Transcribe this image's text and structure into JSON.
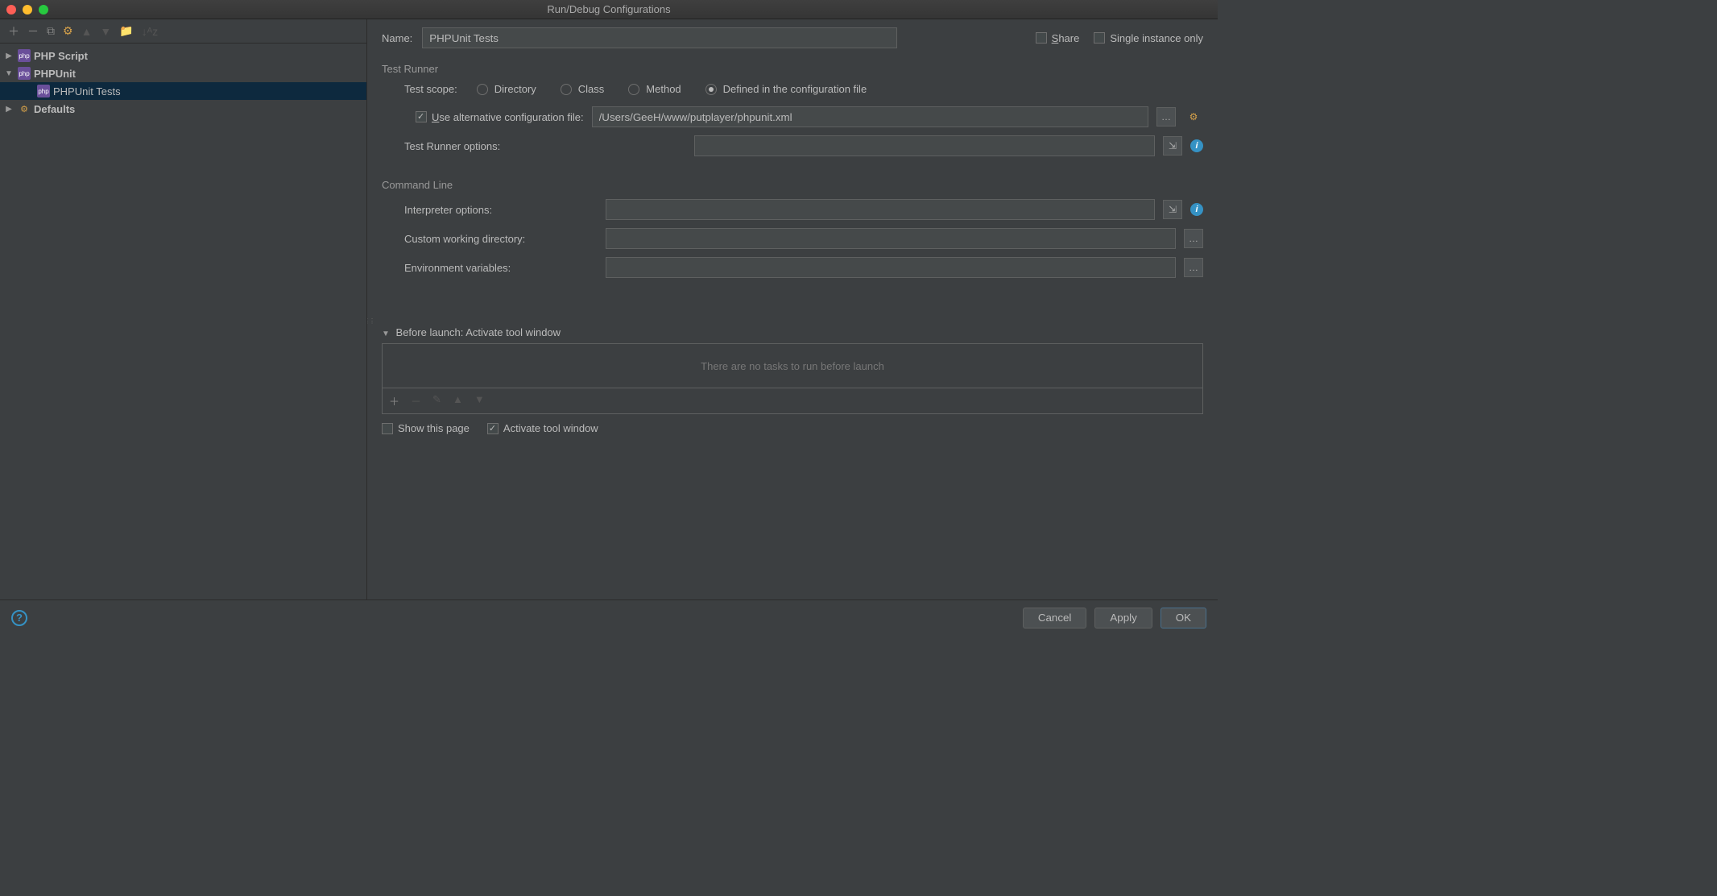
{
  "window": {
    "title": "Run/Debug Configurations"
  },
  "tree": {
    "items": [
      {
        "label": "PHP Script",
        "icon": "php",
        "expanded": false
      },
      {
        "label": "PHPUnit",
        "icon": "php",
        "expanded": true,
        "children": [
          {
            "label": "PHPUnit Tests",
            "icon": "php",
            "selected": true
          }
        ]
      },
      {
        "label": "Defaults",
        "icon": "gear",
        "expanded": false
      }
    ]
  },
  "form": {
    "name_label": "Name:",
    "name_value": "PHPUnit Tests",
    "share_label": "Share",
    "single_instance_label": "Single instance only",
    "test_runner_title": "Test Runner",
    "test_scope_label": "Test scope:",
    "scope_options": {
      "directory": "Directory",
      "class": "Class",
      "method": "Method",
      "config": "Defined in the configuration file"
    },
    "use_alt_config_label": "Use alternative configuration file:",
    "alt_config_value": "/Users/GeeH/www/putplayer/phpunit.xml",
    "test_runner_options_label": "Test Runner options:",
    "test_runner_options_value": "",
    "command_line_title": "Command Line",
    "interpreter_options_label": "Interpreter options:",
    "interpreter_options_value": "",
    "custom_wd_label": "Custom working directory:",
    "custom_wd_value": "",
    "env_vars_label": "Environment variables:",
    "env_vars_value": "",
    "before_launch_title": "Before launch: Activate tool window",
    "no_tasks_text": "There are no tasks to run before launch",
    "show_page_label": "Show this page",
    "activate_tool_label": "Activate tool window"
  },
  "footer": {
    "cancel": "Cancel",
    "apply": "Apply",
    "ok": "OK"
  }
}
